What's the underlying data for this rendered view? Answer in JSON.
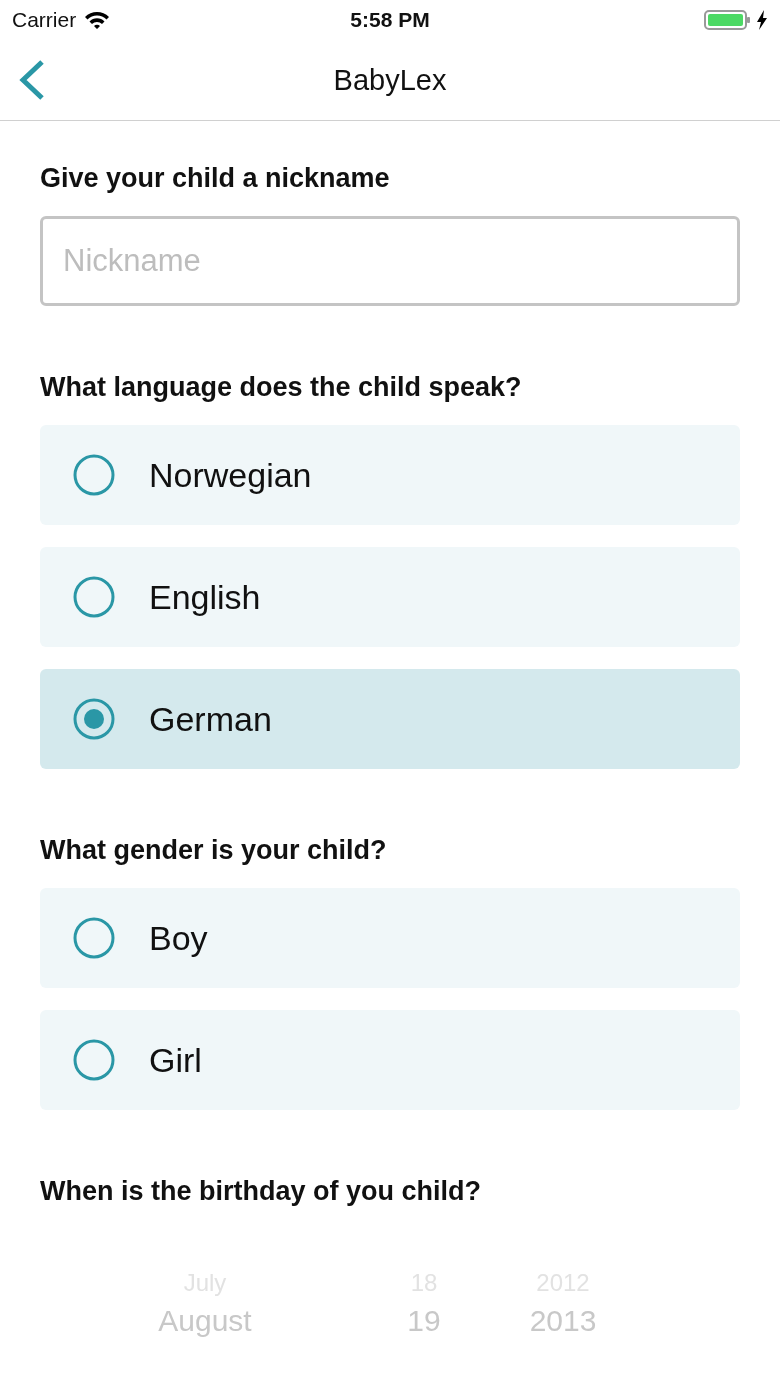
{
  "status_bar": {
    "carrier": "Carrier",
    "time": "5:58 PM"
  },
  "nav_bar": {
    "title": "BabyLex"
  },
  "nickname": {
    "label": "Give your child a nickname",
    "placeholder": "Nickname"
  },
  "language": {
    "label": "What language does the child speak?",
    "options": [
      {
        "label": "Norwegian",
        "selected": false
      },
      {
        "label": "English",
        "selected": false
      },
      {
        "label": "German",
        "selected": true
      }
    ]
  },
  "gender": {
    "label": "What gender is your child?",
    "options": [
      {
        "label": "Boy",
        "selected": false
      },
      {
        "label": "Girl",
        "selected": false
      }
    ]
  },
  "birthday": {
    "label": "When is the birthday of you child?",
    "picker_rows": [
      {
        "month": "July",
        "day": "18",
        "year": "2012",
        "selected": false
      },
      {
        "month": "August",
        "day": "19",
        "year": "2013",
        "selected": true
      }
    ]
  }
}
